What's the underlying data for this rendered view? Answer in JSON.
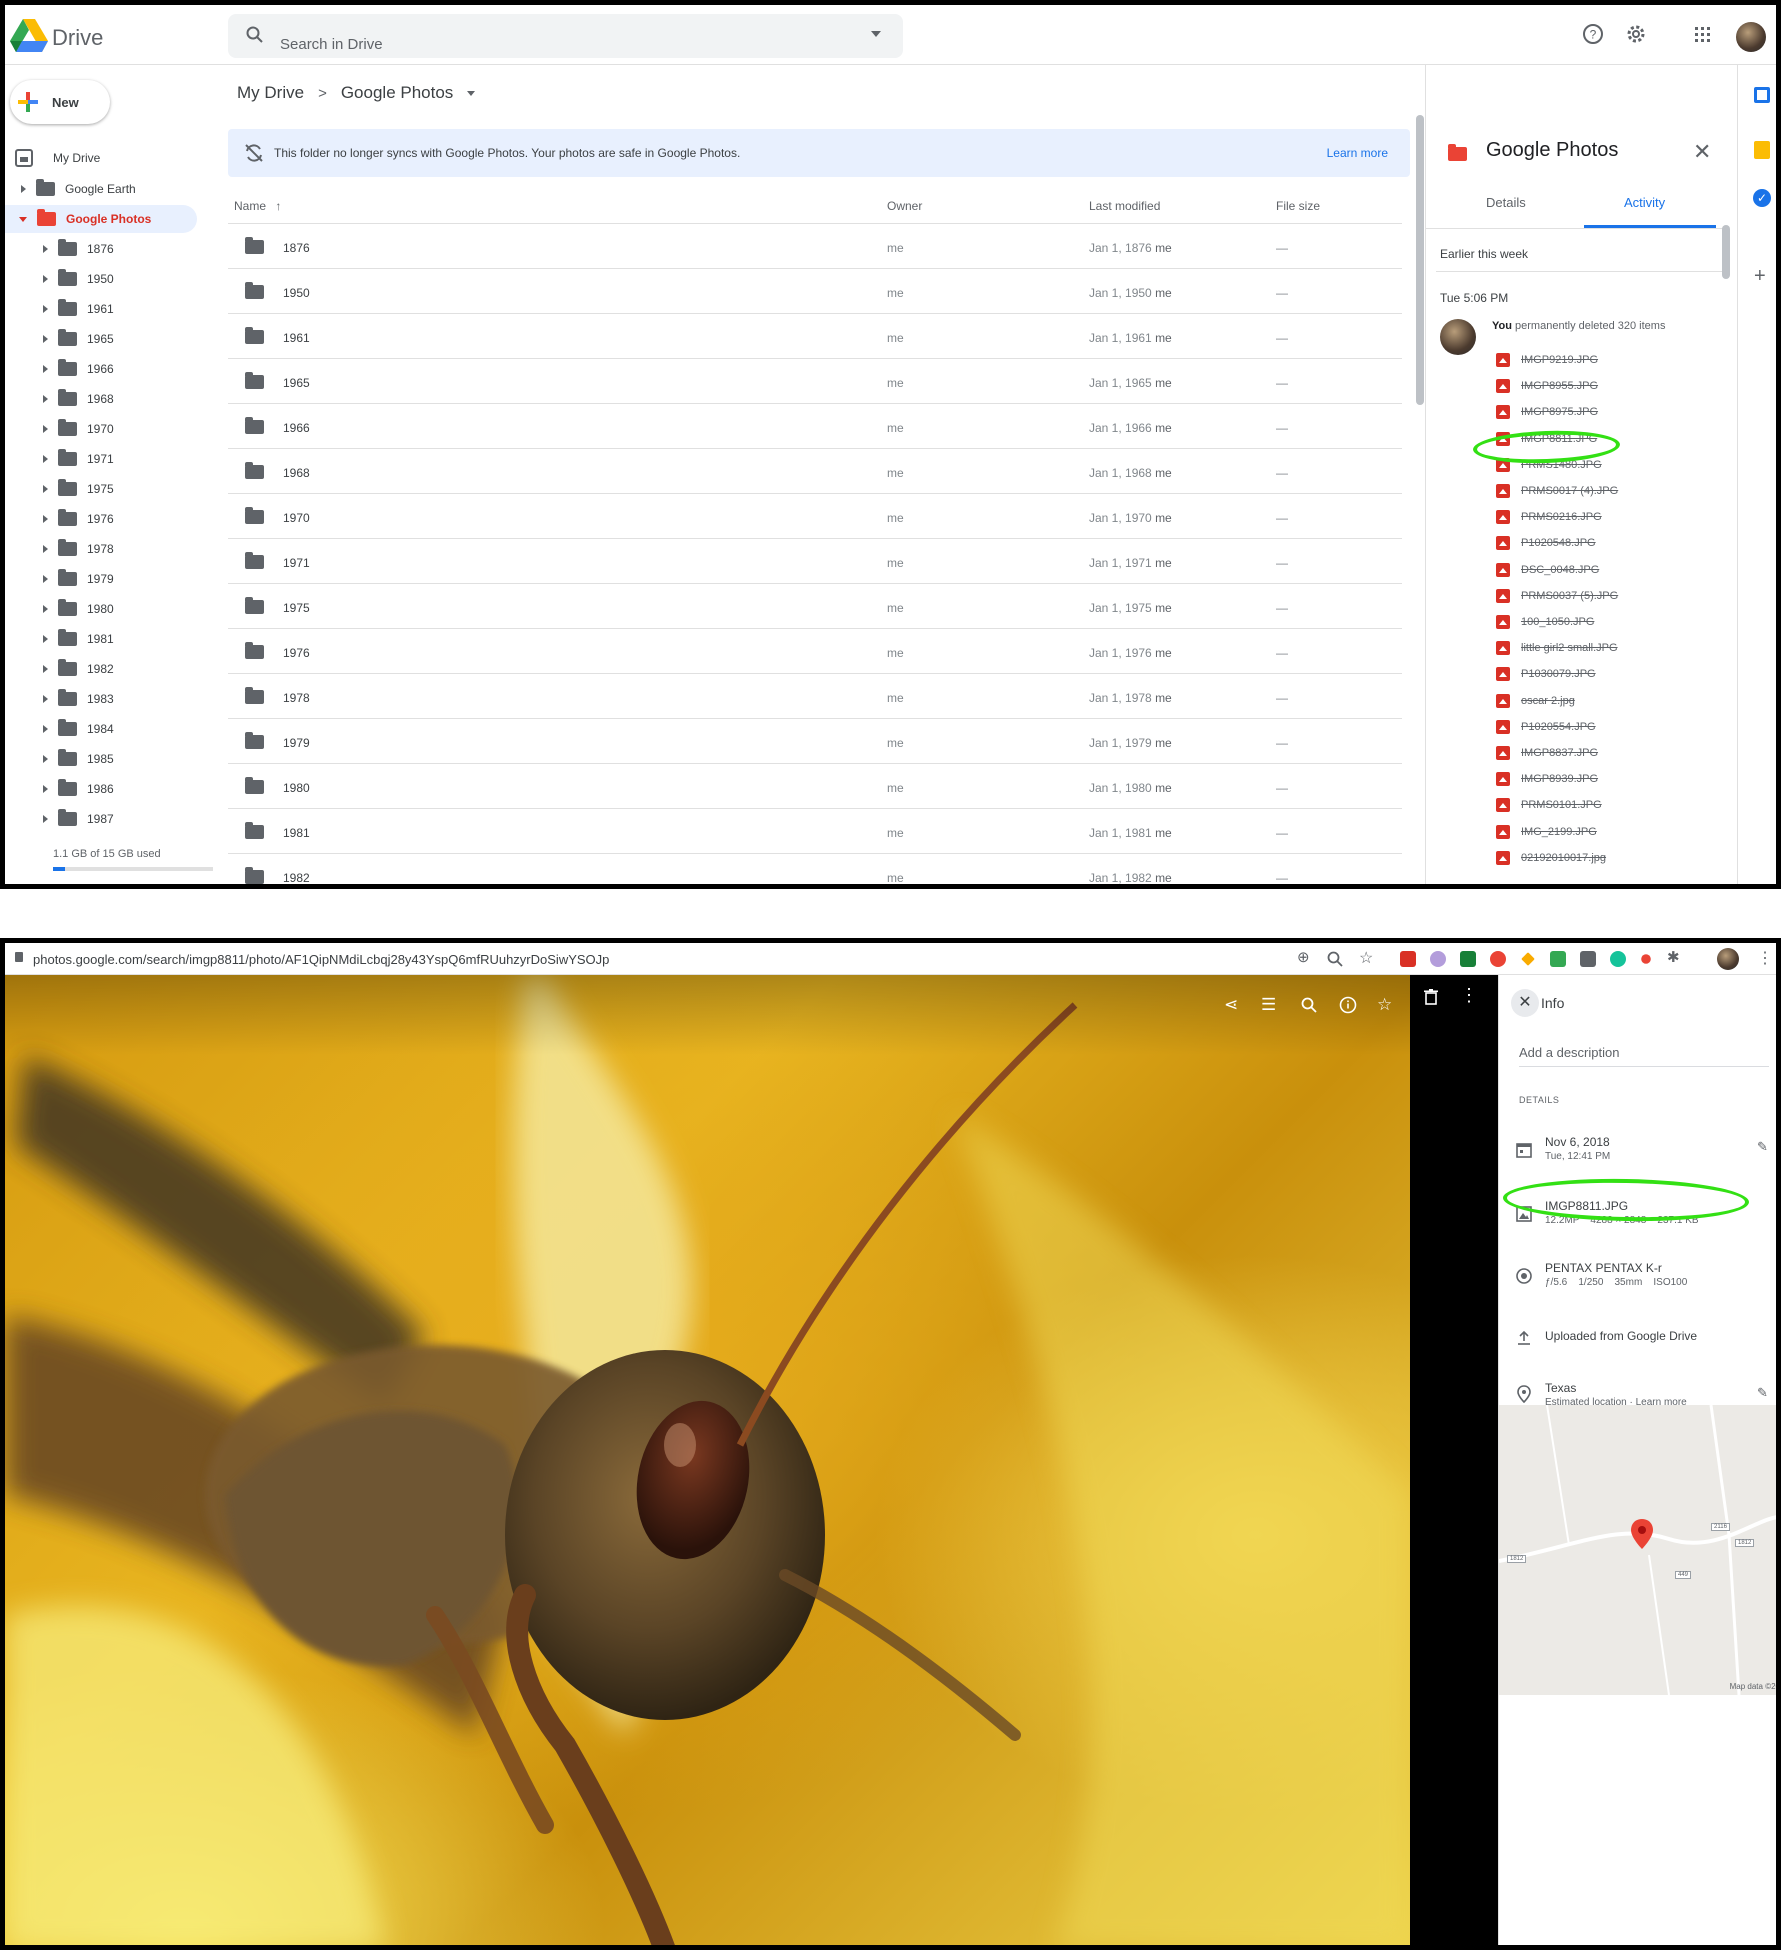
{
  "drive": {
    "app_title": "Drive",
    "search_placeholder": "Search in Drive",
    "new_label": "New",
    "sidebar": {
      "my_drive": "My Drive",
      "google_earth": "Google Earth",
      "google_photos": "Google Photos",
      "years": [
        "1876",
        "1950",
        "1961",
        "1965",
        "1966",
        "1968",
        "1970",
        "1971",
        "1975",
        "1976",
        "1978",
        "1979",
        "1980",
        "1981",
        "1982",
        "1983",
        "1984",
        "1985",
        "1986",
        "1987"
      ],
      "quota_text": "1.1 GB of 15 GB used",
      "quota_fraction": 0.073
    },
    "breadcrumb": {
      "root": "My Drive",
      "sep": ">",
      "current": "Google Photos"
    },
    "banner": {
      "text": "This folder no longer syncs with Google Photos. Your photos are safe in Google Photos.",
      "link": "Learn more"
    },
    "columns": {
      "name": "Name",
      "owner": "Owner",
      "modified": "Last modified",
      "size": "File size"
    },
    "rows": [
      {
        "name": "1876",
        "owner": "me",
        "date": "Jan 1, 1876",
        "by": "me",
        "size": "—"
      },
      {
        "name": "1950",
        "owner": "me",
        "date": "Jan 1, 1950",
        "by": "me",
        "size": "—"
      },
      {
        "name": "1961",
        "owner": "me",
        "date": "Jan 1, 1961",
        "by": "me",
        "size": "—"
      },
      {
        "name": "1965",
        "owner": "me",
        "date": "Jan 1, 1965",
        "by": "me",
        "size": "—"
      },
      {
        "name": "1966",
        "owner": "me",
        "date": "Jan 1, 1966",
        "by": "me",
        "size": "—"
      },
      {
        "name": "1968",
        "owner": "me",
        "date": "Jan 1, 1968",
        "by": "me",
        "size": "—"
      },
      {
        "name": "1970",
        "owner": "me",
        "date": "Jan 1, 1970",
        "by": "me",
        "size": "—"
      },
      {
        "name": "1971",
        "owner": "me",
        "date": "Jan 1, 1971",
        "by": "me",
        "size": "—"
      },
      {
        "name": "1975",
        "owner": "me",
        "date": "Jan 1, 1975",
        "by": "me",
        "size": "—"
      },
      {
        "name": "1976",
        "owner": "me",
        "date": "Jan 1, 1976",
        "by": "me",
        "size": "—"
      },
      {
        "name": "1978",
        "owner": "me",
        "date": "Jan 1, 1978",
        "by": "me",
        "size": "—"
      },
      {
        "name": "1979",
        "owner": "me",
        "date": "Jan 1, 1979",
        "by": "me",
        "size": "—"
      },
      {
        "name": "1980",
        "owner": "me",
        "date": "Jan 1, 1980",
        "by": "me",
        "size": "—"
      },
      {
        "name": "1981",
        "owner": "me",
        "date": "Jan 1, 1981",
        "by": "me",
        "size": "—"
      },
      {
        "name": "1982",
        "owner": "me",
        "date": "Jan 1, 1982",
        "by": "me",
        "size": "—"
      }
    ],
    "panel": {
      "title": "Google Photos",
      "tab_details": "Details",
      "tab_activity": "Activity",
      "earlier": "Earlier this week",
      "timestamp": "Tue 5:06 PM",
      "actor": "You",
      "action": "permanently deleted 320 items",
      "files": [
        "IMGP9219.JPG",
        "IMGP8955.JPG",
        "IMGP8975.JPG",
        "IMGP8811.JPG",
        "PRMS1480.JPG",
        "PRMS0017 (4).JPG",
        "PRMS0216.JPG",
        "P1020548.JPG",
        "DSC_0048.JPG",
        "PRMS0037 (5).JPG",
        "100_1050.JPG",
        "little girl2 small.JPG",
        "P1030079.JPG",
        "oscar 2.jpg",
        "P1020554.JPG",
        "IMGP8837.JPG",
        "IMGP8939.JPG",
        "PRMS0101.JPG",
        "IMG_2199.JPG",
        "02192010017.jpg"
      ]
    }
  },
  "photos": {
    "url": "photos.google.com/search/imgp8811/photo/AF1QipNMdiLcbqj28y43YspQ6mfRUuhzyrDoSiwYSOJp",
    "info_title": "Info",
    "description_placeholder": "Add a description",
    "details_header": "DETAILS",
    "date": "Nov 6, 2018",
    "time": "Tue, 12:41 PM",
    "filename": "IMGP8811.JPG",
    "file_meta": "12.2MP    4288 × 2848    237.1 KB",
    "camera": "PENTAX PENTAX K-r",
    "exif": "ƒ/5.6    1/250    35mm    ISO100",
    "uploaded": "Uploaded from Google Drive",
    "location": "Texas",
    "location_sub": "Estimated location · ",
    "location_link": "Learn more",
    "map_credit": "Map data ©20",
    "road_labels": [
      "2116",
      "1812",
      "1812",
      "449"
    ]
  },
  "colors": {
    "accent": "#1a73e8",
    "folder_red": "#ea4335",
    "highlight": "#33e014",
    "selected_bg": "#e8f0fe"
  }
}
